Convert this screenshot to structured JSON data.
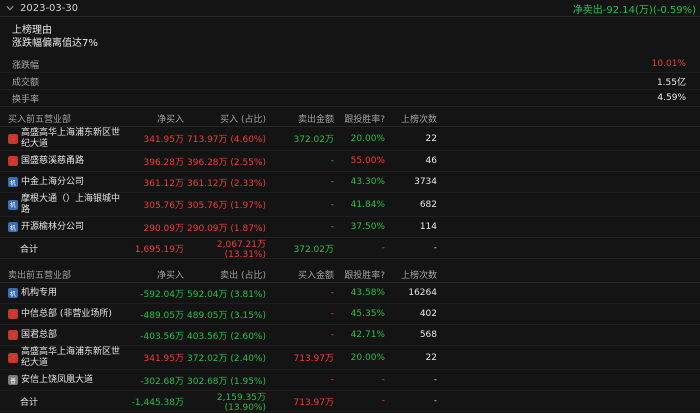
{
  "header": {
    "date": "2023-03-30",
    "summary": "净卖出-92.14(万)(-0.59%)"
  },
  "reason": {
    "title": "上榜理由",
    "text": "涨跌幅偏离值达7%"
  },
  "stats": [
    {
      "label": "涨跌幅",
      "value": "10.01%",
      "color": "red"
    },
    {
      "label": "成交额",
      "value": "1.55亿",
      "color": "white"
    },
    {
      "label": "换手率",
      "value": "4.59%",
      "color": "white"
    }
  ],
  "buy_table": {
    "headers": [
      "买入前五营业部",
      "净买入",
      "买入 (占比)",
      "卖出金额",
      "跟投胜率?",
      "上榜次数"
    ],
    "rows": [
      {
        "badge": "游",
        "badge_color": "red",
        "name": "高盛高华上海浦东新区世纪大道",
        "net": "341.95万",
        "buy": "713.97万 (4.60%)",
        "sell": "372.02万",
        "rate": "20.00%",
        "count": "22"
      },
      {
        "badge": "游",
        "badge_color": "red",
        "name": "国盛慈溪慈甬路",
        "net": "396.28万",
        "buy": "396.28万 (2.55%)",
        "sell": "-",
        "rate": "55.00%",
        "count": "46"
      },
      {
        "badge": "机",
        "badge_color": "blue",
        "name": "中金上海分公司",
        "net": "361.12万",
        "buy": "361.12万 (2.33%)",
        "sell": "-",
        "rate": "43.30%",
        "count": "3734"
      },
      {
        "badge": "机",
        "badge_color": "blue",
        "name": "摩根大通（）上海银城中路",
        "net": "305.76万",
        "buy": "305.76万 (1.97%)",
        "sell": "-",
        "rate": "41.84%",
        "count": "682"
      },
      {
        "badge": "机",
        "badge_color": "blue",
        "name": "开源榆林分公司",
        "net": "290.09万",
        "buy": "290.09万 (1.87%)",
        "sell": "-",
        "rate": "37.50%",
        "count": "114"
      }
    ],
    "total": {
      "label": "合计",
      "net": "1,695.19万",
      "buy": "2,067.21万 (13.31%)",
      "sell": "372.02万",
      "rate": "-",
      "count": "-"
    }
  },
  "sell_table": {
    "headers": [
      "卖出前五营业部",
      "净买入",
      "卖出 (占比)",
      "买入金额",
      "跟投胜率?",
      "上榜次数"
    ],
    "rows": [
      {
        "badge": "机",
        "badge_color": "blue",
        "name": "机构专用",
        "net": "-592.04万",
        "sell": "592.04万 (3.81%)",
        "buy": "-",
        "rate": "43.58%",
        "count": "16264"
      },
      {
        "badge": "游",
        "badge_color": "red",
        "name": "中信总部 (非营业场所)",
        "net": "-489.05万",
        "sell": "489.05万 (3.15%)",
        "buy": "-",
        "rate": "45.35%",
        "count": "402"
      },
      {
        "badge": "游",
        "badge_color": "red",
        "name": "国君总部",
        "net": "-403.56万",
        "sell": "403.56万 (2.60%)",
        "buy": "-",
        "rate": "42.71%",
        "count": "568"
      },
      {
        "badge": "游",
        "badge_color": "red",
        "name": "高盛高华上海浦东新区世纪大道",
        "net": "341.95万",
        "sell": "372.02万 (2.40%)",
        "buy": "713.97万",
        "rate": "20.00%",
        "count": "22"
      },
      {
        "badge": "普",
        "badge_color": "grey",
        "name": "安信上饶凤凰大道",
        "net": "-302.68万",
        "sell": "302.68万 (1.95%)",
        "buy": "-",
        "rate": "-",
        "count": "-"
      }
    ],
    "total": {
      "label": "合计",
      "net": "-1,445.38万",
      "sell": "2,159.35万 (13.90%)",
      "buy": "713.97万",
      "rate": "-",
      "count": "-"
    }
  }
}
